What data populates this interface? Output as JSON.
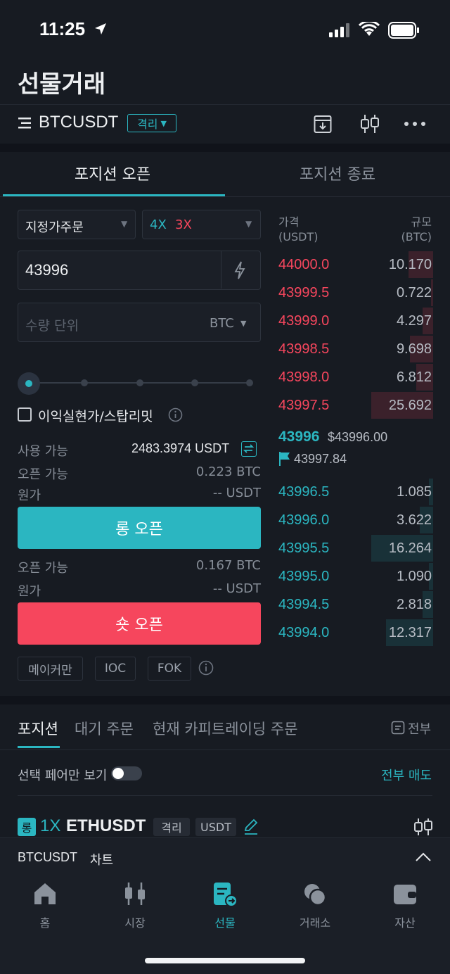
{
  "status_bar": {
    "time": "11:25"
  },
  "page_title": "선물거래",
  "header": {
    "symbol": "BTCUSDT",
    "margin_mode": "격리"
  },
  "tabs": {
    "open": "포지션 오픈",
    "close": "포지션 종료"
  },
  "order_form": {
    "order_type": "지정가주문",
    "leverage_long": "4X",
    "leverage_short": "3X",
    "price_value": "43996",
    "qty_placeholder": "수량 단위",
    "qty_unit": "BTC",
    "tpsl_label": "이익실현가/스탑리밋",
    "available_label": "사용 가능",
    "available_value": "2483.3974 USDT",
    "long_open_able_label": "오픈 가능",
    "long_open_able_value": "0.223 BTC",
    "long_cost_label": "원가",
    "long_cost_value": "-- USDT",
    "long_button": "롱 오픈",
    "short_open_able_label": "오픈 가능",
    "short_open_able_value": "0.167 BTC",
    "short_cost_label": "원가",
    "short_cost_value": "-- USDT",
    "short_button": "숏 오픈",
    "chips": [
      "메이커만",
      "IOC",
      "FOK"
    ]
  },
  "orderbook": {
    "price_header_1": "가격",
    "price_header_2": "(USDT)",
    "size_header_1": "규모",
    "size_header_2": "(BTC)",
    "asks": [
      {
        "price": "44000.0",
        "size": "10.170",
        "depth": 0.4
      },
      {
        "price": "43999.5",
        "size": "0.722",
        "depth": 0.03
      },
      {
        "price": "43999.0",
        "size": "4.297",
        "depth": 0.17
      },
      {
        "price": "43998.5",
        "size": "9.698",
        "depth": 0.38
      },
      {
        "price": "43998.0",
        "size": "6.812",
        "depth": 0.27
      },
      {
        "price": "43997.5",
        "size": "25.692",
        "depth": 1.0
      }
    ],
    "last_price": "43996",
    "last_price_usd": "$43996.00",
    "mark_price": "43997.84",
    "bids": [
      {
        "price": "43996.5",
        "size": "1.085",
        "depth": 0.07
      },
      {
        "price": "43996.0",
        "size": "3.622",
        "depth": 0.22
      },
      {
        "price": "43995.5",
        "size": "16.264",
        "depth": 1.0
      },
      {
        "price": "43995.0",
        "size": "1.090",
        "depth": 0.07
      },
      {
        "price": "43994.5",
        "size": "2.818",
        "depth": 0.17
      },
      {
        "price": "43994.0",
        "size": "12.317",
        "depth": 0.76
      }
    ]
  },
  "positions": {
    "tabs": [
      "포지션",
      "대기 주문",
      "현재 카피트레이딩 주문"
    ],
    "all_label": "전부",
    "selected_pair_only": "선택 페어만 보기",
    "close_all": "전부 매도",
    "item": {
      "side": "롱",
      "leverage": "1X",
      "symbol": "ETHUSDT",
      "mode": "격리",
      "currency": "USDT"
    }
  },
  "chart_bar": {
    "symbol": "BTCUSDT",
    "label": "차트"
  },
  "bottom_nav": [
    "홈",
    "시장",
    "선물",
    "거래소",
    "자산"
  ],
  "colors": {
    "accent": "#2bb6c1",
    "sell": "#f6465d",
    "buy": "#2bb6c1",
    "bg": "#171b22"
  }
}
